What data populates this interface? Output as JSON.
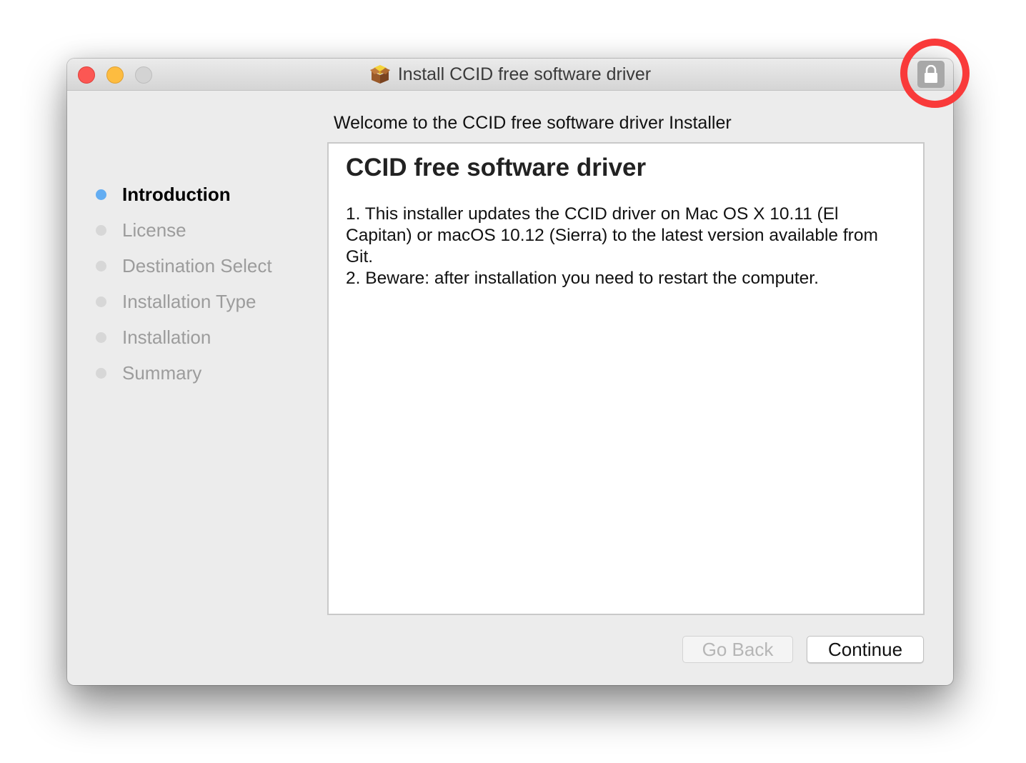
{
  "window": {
    "title": "Install CCID free software driver",
    "icons": {
      "app": "package-icon",
      "lock": "lock-icon"
    }
  },
  "sidebar": {
    "steps": [
      {
        "label": "Introduction",
        "active": true
      },
      {
        "label": "License",
        "active": false
      },
      {
        "label": "Destination Select",
        "active": false
      },
      {
        "label": "Installation Type",
        "active": false
      },
      {
        "label": "Installation",
        "active": false
      },
      {
        "label": "Summary",
        "active": false
      }
    ]
  },
  "main": {
    "welcome": "Welcome to the CCID free software driver Installer",
    "heading": "CCID free software driver",
    "lines": [
      "1. This installer updates the CCID driver on Mac OS X 10.11 (El Capitan) or macOS 10.12 (Sierra) to the latest version available from Git.",
      "2. Beware: after installation you need to restart the computer."
    ]
  },
  "buttons": {
    "back": "Go Back",
    "continue": "Continue"
  },
  "colors": {
    "annotation": "#f93a3a",
    "active_step": "#63adf2"
  }
}
